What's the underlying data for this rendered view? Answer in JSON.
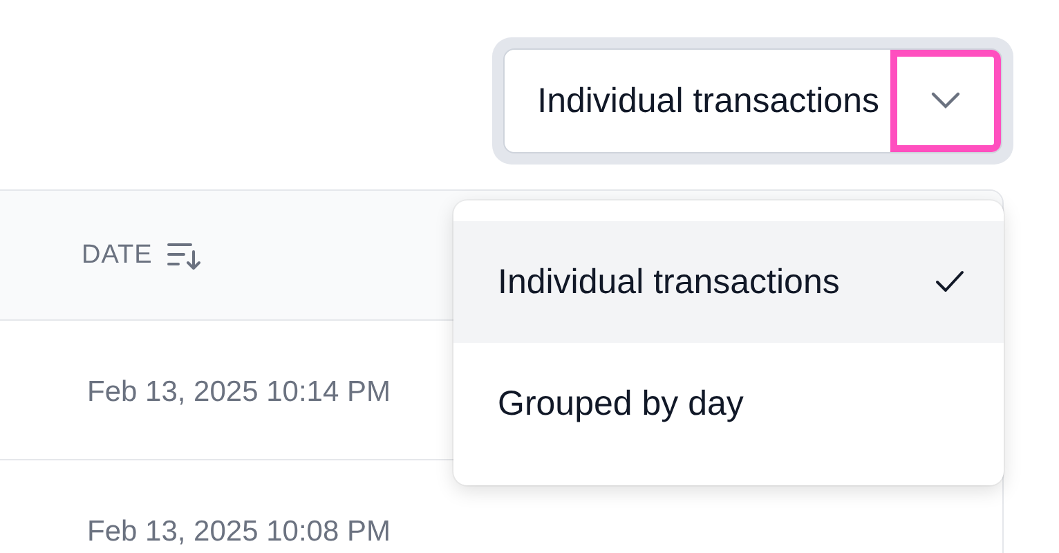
{
  "select": {
    "value": "Individual transactions",
    "expanded": true
  },
  "table": {
    "columns": [
      {
        "label": "DATE"
      }
    ],
    "rows": [
      {
        "date": "Feb 13, 2025 10:14 PM"
      },
      {
        "date": "Feb 13, 2025 10:08 PM"
      }
    ]
  },
  "menu": {
    "options": [
      {
        "label": "Individual transactions",
        "selected": true
      },
      {
        "label": "Grouped by day",
        "selected": false
      }
    ]
  }
}
